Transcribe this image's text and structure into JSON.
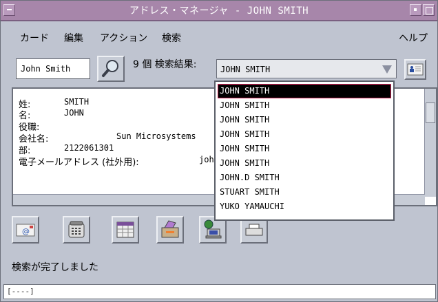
{
  "window": {
    "title": "アドレス・マネージャ - JOHN SMITH"
  },
  "menu": {
    "card": "カード",
    "edit": "編集",
    "action": "アクション",
    "search": "検索",
    "help": "ヘルプ"
  },
  "toolbar": {
    "name_value": "John Smith",
    "count_label": "9 個 検索結果:",
    "selected_result": "JOHN SMITH"
  },
  "dropdown": {
    "options": [
      "JOHN SMITH",
      "JOHN SMITH",
      "JOHN SMITH",
      "JOHN SMITH",
      "JOHN SMITH",
      "JOHN SMITH",
      "JOHN.D SMITH",
      "STUART SMITH",
      "YUKO YAMAUCHI"
    ]
  },
  "detail": {
    "last_name_label": "姓:",
    "last_name": "SMITH",
    "first_name_label": "名:",
    "first_name": "JOHN",
    "title_label": "役職:",
    "company_label": "会社名:",
    "company": "Sun Microsystems",
    "dept_label": "部:",
    "dept": "2122061301",
    "email_label": "電子メールアドレス (社外用):",
    "email_partial": "joh"
  },
  "status": {
    "message": "検索が完了しました",
    "footer": "[----]"
  },
  "colors": {
    "titlebar": "#a786aa",
    "background": "#bfc4d0",
    "selection": "#000000"
  },
  "icons": [
    "mail-icon",
    "phone-icon",
    "calendar-icon",
    "fax-icon",
    "computer-icon",
    "printer-icon"
  ]
}
